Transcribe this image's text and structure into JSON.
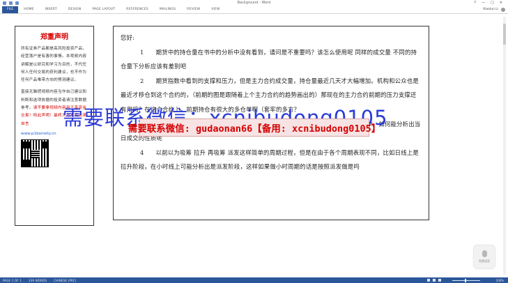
{
  "window": {
    "title": "Background - Word",
    "controls": [
      "?",
      "—",
      "□",
      "✕"
    ]
  },
  "ribbon": {
    "tabs": [
      "FILE",
      "HOME",
      "INSERT",
      "DESIGN",
      "PAGE LAYOUT",
      "REFERENCES",
      "MAILINGS",
      "REVIEW",
      "VIEW"
    ],
    "user": "Xiaolun Li"
  },
  "notice": {
    "title": "郑重声明",
    "para1": "所有证券产品都是高风险投资产品，经营落户是有害的事情。本视频内容讲解是以研究和学习为目的，不代任何人任何交易的获利建议，也不作为任何产品唯带方向的预测建议。",
    "para2_prefix": "直接无脑把视频内容当作自己建议和判断和选项依据的投资者请注意",
    "para2_mid": "数据参考。",
    "para2_red": "请不要拿视频内容用于真资金交易！特此声明！最终大方案高亲来自言",
    "link": "www.p1bonoity.cn"
  },
  "document": {
    "greeting": "您好:",
    "paragraphs": [
      "1　　期货中的持仓量在书中的分析中没有看到，请问是不重要吗？该怎么使用呢 同样的成交量 不同的持仓量下分析应该有差别吧",
      "2　　期货指数中看到的支撑和压力，但是主力合约成交量，持仓量最近几天才大幅增加。机构和公众也是最近才移仓到这个合约的，（前期的图是跟随着上个主力合约的趋势画出的）那现在的主力合约前期的压力支撑还有用吗？在这个合约上，前期持仓有很大的多仓单啊（套牢的多方？",
      "3　　（略）......的也是一堆小单成交，同样 cm 卖 1000 手 公众接单也是一堆小成交单，如何能分析出当日成交的性质呢",
      "4　　以前以为吸筹 拉升 再吸筹 派发这样简单的周期过程，但是在由于各个周期表现不同，比如日线上是拉升阶段，在小时线上可能分析出是派发阶段，这样如果做小时周期的话是按照派发做是吗"
    ]
  },
  "watermark": {
    "big": "需要联系微信：xcnibudong0105",
    "strip": "需要联系微信: gudaonan66【备用: xcnibudong0105】"
  },
  "widget": {
    "label": "免费语音"
  },
  "statusbar": {
    "page": "PAGE 1 OF 1",
    "words": "339 WORDS",
    "language": "CHINESE (PRC)",
    "zoom": "100%"
  },
  "colors": {
    "accent": "#2b579a",
    "notice_red": "#d40000",
    "watermark_blue": "#1a2bd6"
  }
}
